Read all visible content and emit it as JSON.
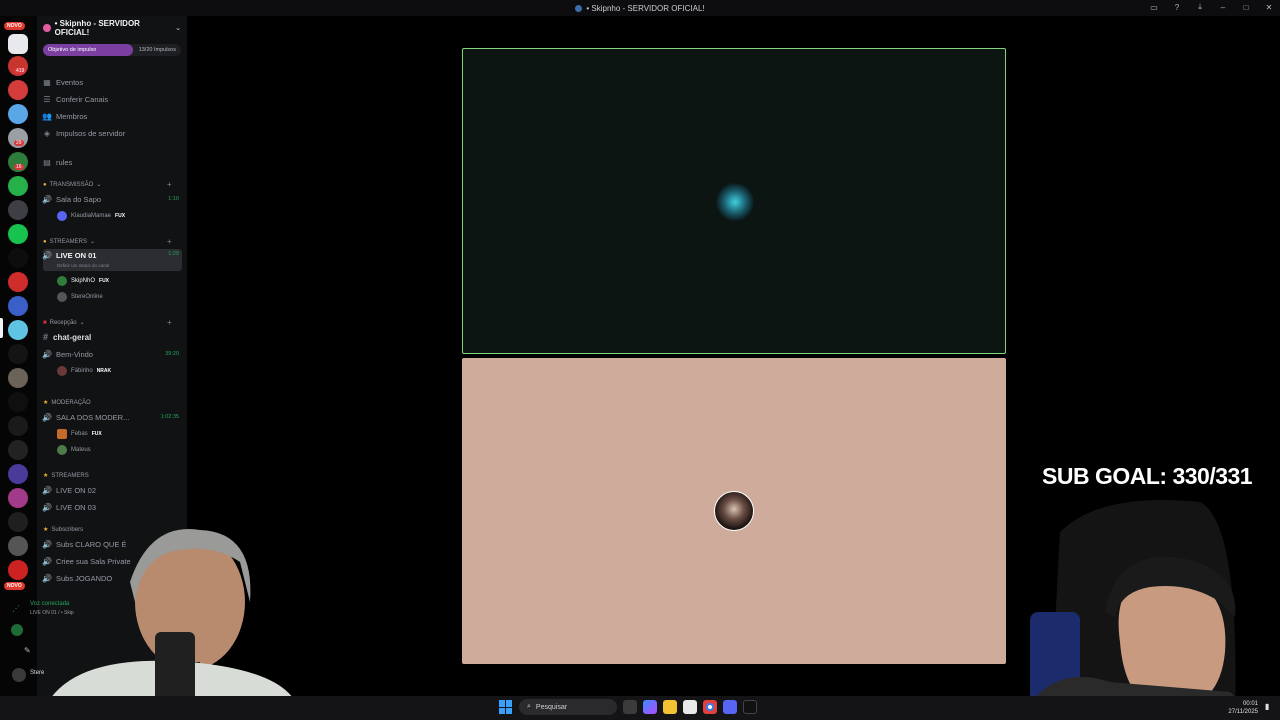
{
  "window": {
    "title": "• Skipnho - SERVIDOR OFICIAL!"
  },
  "sidebar": {
    "server_name": "• Skipnho - SERVIDOR OFICIAL!",
    "boost": {
      "label": "Objetivo de impulso",
      "count": "13/20 Impulsos",
      "progress": 0.65
    },
    "nav": [
      {
        "label": "Eventos",
        "icon": "calendar-icon"
      },
      {
        "label": "Conferir Canais",
        "icon": "channels-icon"
      },
      {
        "label": "Membros",
        "icon": "members-icon"
      },
      {
        "label": "Impulsos de servidor",
        "icon": "boost-icon"
      }
    ],
    "rules": "rules",
    "categories": {
      "transmissao": "TRANSMISSÃO",
      "streamers": "STREAMERS",
      "recepcao": "Recepção",
      "moderacao": "MODERAÇÃO",
      "streamers2": "STREAMERS",
      "subscribers": "Subscribers"
    },
    "channels": {
      "sala_sapo": {
        "label": "Sala do Sapo",
        "time": "1:10"
      },
      "klaudia": {
        "name": "KlaudiaMamae",
        "tag": "FUX"
      },
      "live01": {
        "label": "LIVE ON 01",
        "time": "1:29",
        "status": "Definir um status do canal"
      },
      "skipnho": {
        "name": "SkipNhO",
        "tag": "FUX"
      },
      "stereo": {
        "name": "StereOnline"
      },
      "chat_geral": "chat-geral",
      "bem_vindo": {
        "label": "Bem-Vindo",
        "time": "39:20"
      },
      "fabinho": {
        "name": "Fábinho",
        "tag": "NRAK"
      },
      "sala_mod": {
        "label": "SALA DOS MODER...",
        "time": "1:02:35"
      },
      "febas": {
        "name": "Febas",
        "tag": "FUX"
      },
      "mateus": {
        "name": "Mateus"
      },
      "live02": "LIVE ON 02",
      "live03": "LIVE ON 03",
      "subs_claro": "Subs CLARO QUE É",
      "criee": "Criee sua Sala Private",
      "subs_jogando": "Subs JOGANDO"
    },
    "voice": {
      "status": "Voz conectada",
      "channel": "LIVE ON 01 / • Skip"
    },
    "user_name": "Stere"
  },
  "rail": {
    "new_badge": "NOVO",
    "counts": [
      "419",
      "36",
      "29",
      "16"
    ]
  },
  "overlay": {
    "sub_goal": "SUB GOAL: 330/331"
  },
  "taskbar": {
    "search_placeholder": "Pesquisar",
    "time": "00:01",
    "date": "27/11/2025"
  }
}
